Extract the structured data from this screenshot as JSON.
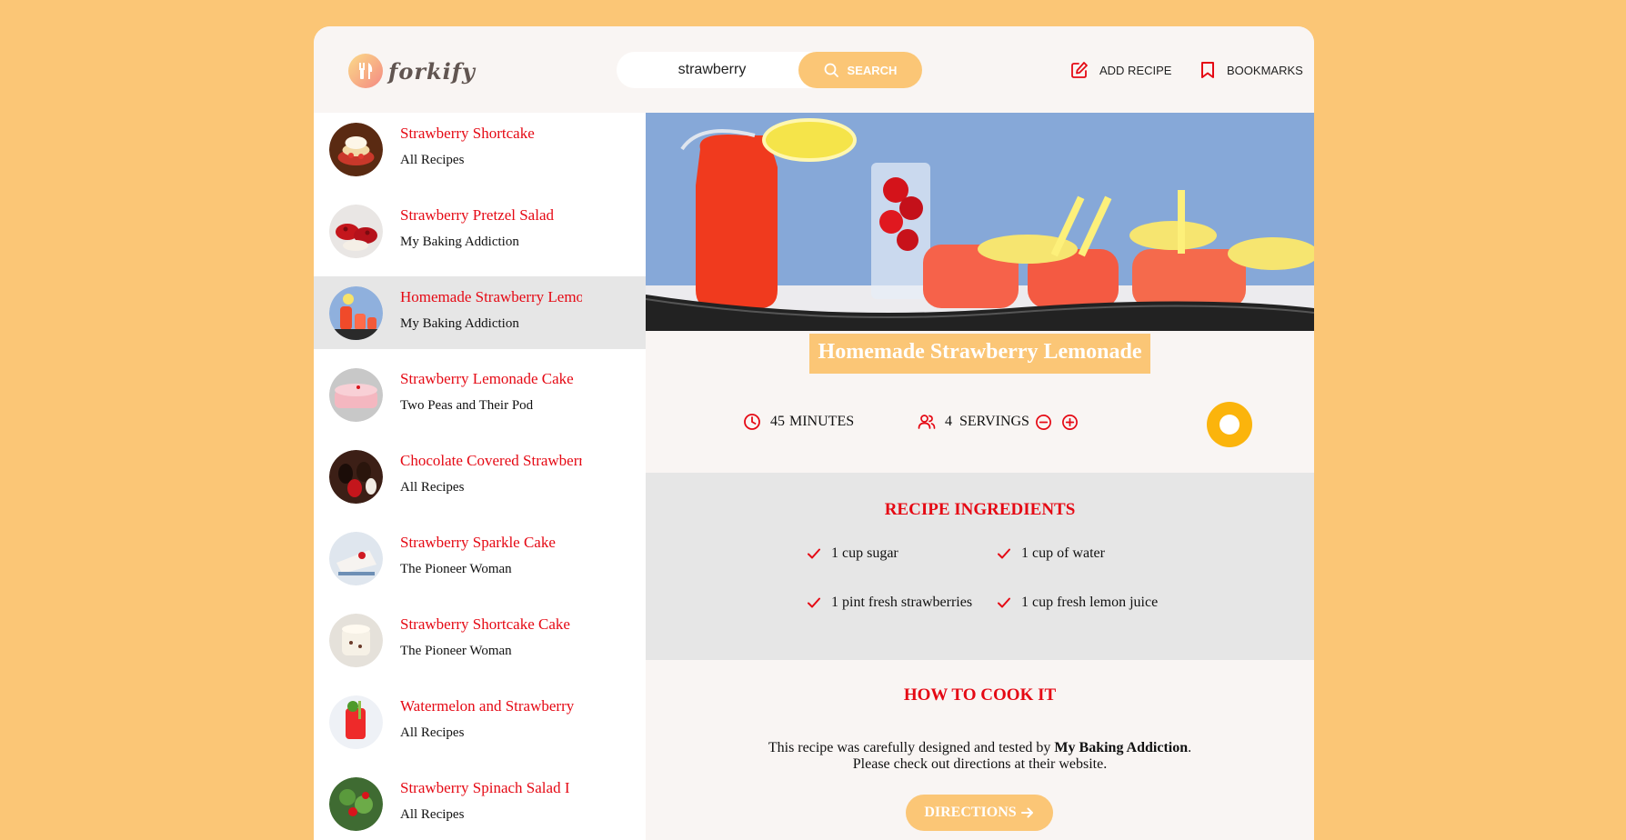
{
  "header": {
    "logo_text": "forkify",
    "search_value": "strawberry",
    "search_label": "SEARCH",
    "add_recipe_label": "ADD RECIPE",
    "bookmarks_label": "BOOKMARKS"
  },
  "results": [
    {
      "title": "Strawberry Shortcake",
      "publisher": "All Recipes"
    },
    {
      "title": "Strawberry Pretzel Salad",
      "publisher": "My Baking Addiction"
    },
    {
      "title": "Homemade Strawberry Lemonade",
      "publisher": "My Baking Addiction"
    },
    {
      "title": "Strawberry Lemonade Cake",
      "publisher": "Two Peas and Their Pod"
    },
    {
      "title": "Chocolate Covered Strawberries",
      "publisher": "All Recipes"
    },
    {
      "title": "Strawberry Sparkle Cake",
      "publisher": "The Pioneer Woman"
    },
    {
      "title": "Strawberry Shortcake Cake",
      "publisher": "The Pioneer Woman"
    },
    {
      "title": "Watermelon and Strawberry",
      "publisher": "All Recipes"
    },
    {
      "title": "Strawberry Spinach Salad I",
      "publisher": "All Recipes"
    }
  ],
  "recipe": {
    "title": "Homemade Strawberry Lemonade",
    "cooking_time": "45",
    "time_unit": "MINUTES",
    "servings": "4",
    "servings_label": "SERVINGS",
    "ingredients_title": "RECIPE INGREDIENTS",
    "ingredients": [
      "1 cup sugar",
      "1 cup of water",
      "1 pint fresh strawberries",
      "1 cup fresh lemon juice"
    ],
    "cook_title": "HOW TO COOK IT",
    "cook_text_prefix": "This recipe was carefully designed and tested by ",
    "publisher": "My Baking Addiction",
    "cook_text_suffix": ".",
    "cook_text_line2": "Please check out directions at their website.",
    "directions_label": "DIRECTIONS"
  },
  "colors": {
    "accent": "#fbc676",
    "title_red": "#e50914",
    "bookmark_yellow": "#fbb40c",
    "active_row": "#e6e6e6"
  }
}
